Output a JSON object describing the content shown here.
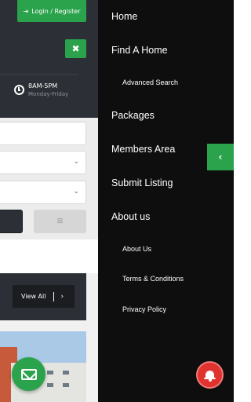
{
  "header": {
    "login_label": "Login / Register",
    "close_label": "✖",
    "hours_time": "8AM-5PM",
    "hours_days": "Monday-Friday"
  },
  "search_form": {
    "select_chevron": "⌄",
    "advanced_icon": "⊞"
  },
  "listings": {
    "view_all_label": "View All",
    "view_all_arrow": "›"
  },
  "menu": {
    "items": [
      {
        "label": "Home"
      },
      {
        "label": "Find A Home"
      },
      {
        "label": "Advanced Search"
      },
      {
        "label": "Packages"
      },
      {
        "label": "Members Area"
      },
      {
        "label": "Submit Listing"
      },
      {
        "label": "About us"
      },
      {
        "label": "About Us"
      },
      {
        "label": "Terms & Conditions"
      },
      {
        "label": "Privacy Policy"
      }
    ],
    "collapse_icon": "‹"
  },
  "colors": {
    "accent": "#2ba24c",
    "dark_header": "#2c2f35",
    "drawer_bg": "#0e0e0e",
    "notification": "#e0322f"
  }
}
